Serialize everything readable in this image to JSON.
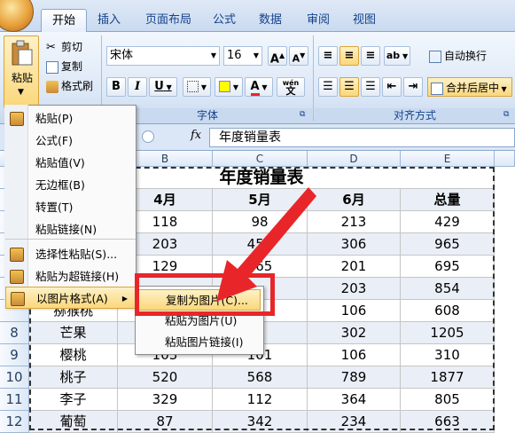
{
  "tabs": [
    {
      "label": "开始",
      "active": true
    },
    {
      "label": "插入"
    },
    {
      "label": "页面布局"
    },
    {
      "label": "公式"
    },
    {
      "label": "数据"
    },
    {
      "label": "审阅"
    },
    {
      "label": "视图"
    }
  ],
  "ribbon": {
    "paste_label": "粘贴",
    "cut_label": "剪切",
    "copy_label": "复制",
    "format_painter_label": "格式刷",
    "font_name": "宋体",
    "font_size": "16",
    "font_group_label": "字体",
    "align_group_label": "对齐方式",
    "wrap_text_label": "自动换行",
    "merge_center_label": "合并后居中",
    "grow_font": "A",
    "shrink_font": "A",
    "bold": "B",
    "italic": "I",
    "underline": "U",
    "font_color_glyph": "A",
    "phonetic_glyph": "wén",
    "phonetic_char": "文"
  },
  "formula_bar": {
    "fx": "fx",
    "content": "年度销量表"
  },
  "colors": {
    "accent_red": "#e8262a",
    "ribbon_blue": "#15428b",
    "highlight": "#fbd77a"
  },
  "sheet": {
    "columns": [
      "B",
      "C",
      "D",
      "E"
    ],
    "title": "年度销量表",
    "headers": [
      "4月",
      "5月",
      "6月",
      "总量"
    ],
    "rows": [
      {
        "num": "",
        "name": "",
        "values": [
          "118",
          "98",
          "213",
          "429"
        ]
      },
      {
        "num": "",
        "name": "",
        "values": [
          "203",
          "456",
          "306",
          "965"
        ]
      },
      {
        "num": "",
        "name": "",
        "values": [
          "129",
          "365",
          "201",
          "695"
        ]
      },
      {
        "num": "",
        "name": "",
        "values": [
          "",
          "",
          "203",
          "854"
        ]
      },
      {
        "num": "",
        "name": "猕猴桃",
        "values": [
          "",
          "",
          "106",
          "608"
        ]
      },
      {
        "num": "8",
        "name": "芒果",
        "values": [
          "",
          "5",
          "302",
          "1205"
        ]
      },
      {
        "num": "9",
        "name": "樱桃",
        "values": [
          "103",
          "101",
          "106",
          "310"
        ]
      },
      {
        "num": "10",
        "name": "桃子",
        "values": [
          "520",
          "568",
          "789",
          "1877"
        ]
      },
      {
        "num": "11",
        "name": "李子",
        "values": [
          "329",
          "112",
          "364",
          "805"
        ]
      },
      {
        "num": "12",
        "name": "葡萄",
        "values": [
          "87",
          "342",
          "234",
          "663"
        ]
      }
    ]
  },
  "paste_menu": {
    "items": [
      {
        "label": "粘贴(P)",
        "icon": "paste-icon"
      },
      {
        "label": "公式(F)",
        "icon": ""
      },
      {
        "label": "粘贴值(V)",
        "icon": ""
      },
      {
        "label": "无边框(B)",
        "icon": ""
      },
      {
        "label": "转置(T)",
        "icon": ""
      },
      {
        "label": "粘贴链接(N)",
        "icon": ""
      },
      {
        "label": "选择性粘贴(S)...",
        "icon": "paste-special-icon"
      },
      {
        "label": "粘贴为超链接(H)",
        "icon": "hyperlink-icon"
      },
      {
        "label": "以图片格式(A)",
        "icon": "picture-icon",
        "highlighted": true
      }
    ]
  },
  "picture_submenu": {
    "items": [
      {
        "label": "复制为图片(C)...",
        "highlighted": true
      },
      {
        "label": "粘贴为图片(U)"
      },
      {
        "label": "粘贴图片链接(I)"
      }
    ]
  }
}
